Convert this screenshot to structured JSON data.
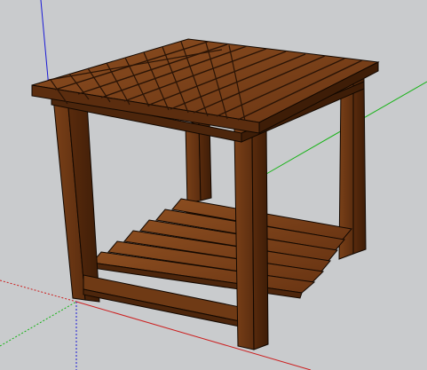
{
  "viewport": {
    "background_color": "#c9cbcd",
    "axes": {
      "red_axis_color": "#cc1f1f",
      "green_axis_color": "#17b317",
      "blue_axis_color": "#1a1ad6"
    }
  },
  "model": {
    "subject": "wooden-end-table",
    "colors": {
      "wood_light": "#8a4a1c",
      "wood_mid": "#6f3a15",
      "wood_dark": "#4d260c",
      "wood_edge": "#2a1406",
      "outline": "#120801"
    }
  }
}
